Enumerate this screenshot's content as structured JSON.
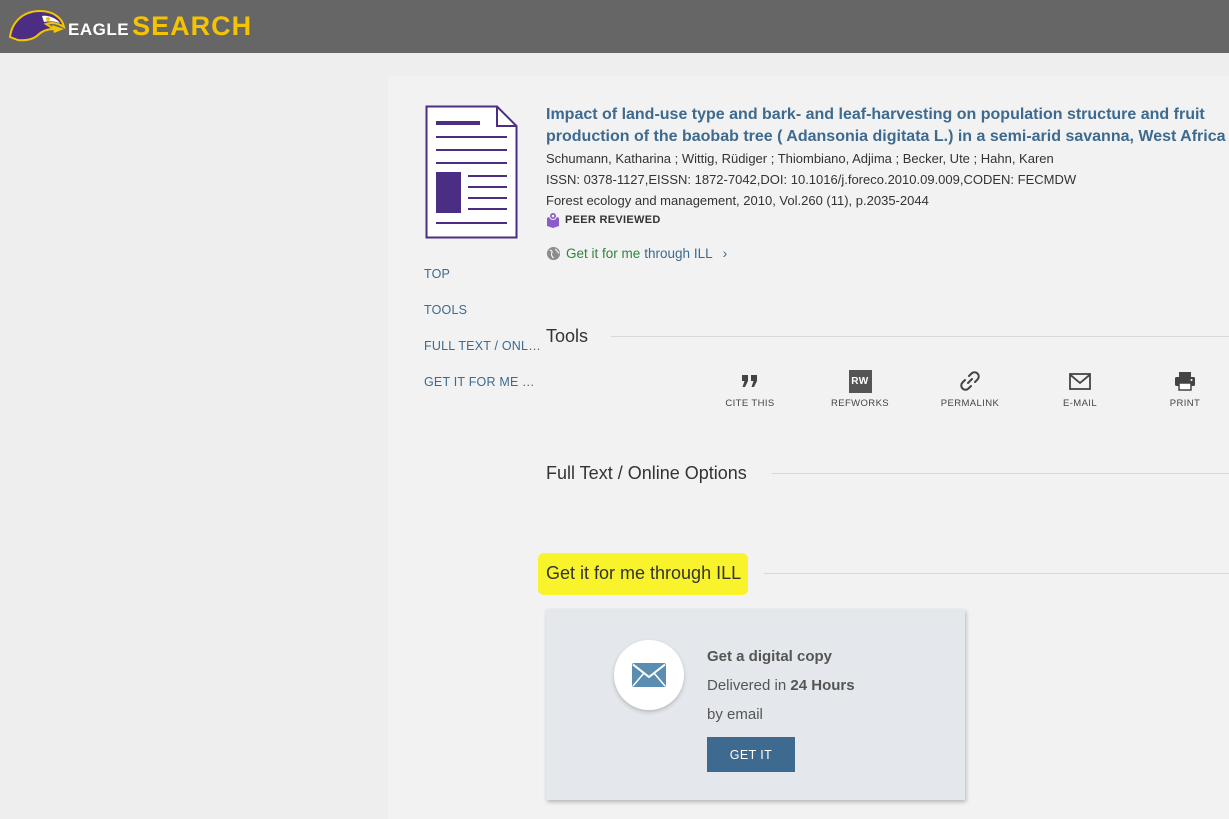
{
  "header": {
    "logo_eagle": "EAGLE",
    "logo_search": "SEARCH"
  },
  "sidenav": {
    "items": [
      "TOP",
      "TOOLS",
      "FULL TEXT / ONLINE OPTIONS",
      "GET IT FOR ME THROUGH ILL"
    ]
  },
  "record": {
    "title_line1": "Impact of land-use type and bark- and leaf-harvesting on population structure and fruit",
    "title_line2": "production of the baobab tree ( Adansonia digitata L.) in a semi-arid savanna, West Africa",
    "authors": "Schumann, Katharina ; Wittig, Rüdiger ; Thiombiano, Adjima ; Becker, Ute ; Hahn, Karen",
    "identifiers": "ISSN: 0378-1127,EISSN: 1872-7042,DOI: 10.1016/j.foreco.2010.09.009,CODEN: FECMDW",
    "source": "Forest ecology and management, 2010, Vol.260 (11), p.2035-2044",
    "peer_reviewed": "PEER REVIEWED",
    "ill_link_part1": "Get it for me",
    "ill_link_part2": "through ILL"
  },
  "sections": {
    "tools": "Tools",
    "full_text": "Full Text / Online Options",
    "ill": "Get it for me through ILL"
  },
  "tools": {
    "cite": "CITE THIS",
    "refworks_badge": "RW",
    "refworks": "REFWORKS",
    "permalink": "PERMALINK",
    "email": "E-MAIL",
    "print": "PRINT"
  },
  "ill_card": {
    "heading": "Get a digital copy",
    "delivered_prefix": "Delivered in",
    "delivered_time": "24 Hours",
    "method": "by email",
    "button": "GET IT"
  },
  "colors": {
    "header_bg": "#666666",
    "link": "#3d6a8e",
    "highlight": "#f8f32b",
    "logo_gold": "#f5c400",
    "doc_icon": "#4b2e83"
  }
}
